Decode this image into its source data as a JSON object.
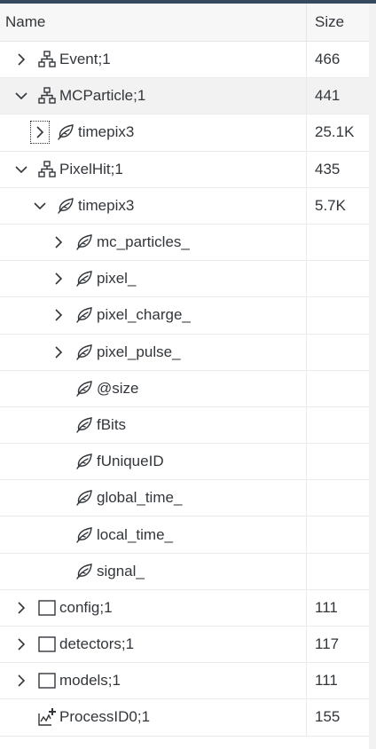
{
  "header": {
    "name": "Name",
    "size": "Size"
  },
  "rows": [
    {
      "label": "Event;1",
      "size": "466",
      "level": 0,
      "arrow": "right",
      "icon": "tree-icon",
      "selected": false,
      "focus": false
    },
    {
      "label": "MCParticle;1",
      "size": "441",
      "level": 0,
      "arrow": "down",
      "icon": "tree-icon",
      "selected": true,
      "focus": false
    },
    {
      "label": "timepix3",
      "size": "25.1K",
      "level": 1,
      "arrow": "right",
      "icon": "leaf-icon",
      "selected": false,
      "focus": true
    },
    {
      "label": "PixelHit;1",
      "size": "435",
      "level": 0,
      "arrow": "down",
      "icon": "tree-icon",
      "selected": false,
      "focus": false
    },
    {
      "label": "timepix3",
      "size": "5.7K",
      "level": 1,
      "arrow": "down",
      "icon": "leaf-icon",
      "selected": false,
      "focus": false
    },
    {
      "label": "mc_particles_",
      "size": "",
      "level": 2,
      "arrow": "right",
      "icon": "leaf-icon",
      "selected": false,
      "focus": false
    },
    {
      "label": "pixel_",
      "size": "",
      "level": 2,
      "arrow": "right",
      "icon": "leaf-icon",
      "selected": false,
      "focus": false
    },
    {
      "label": "pixel_charge_",
      "size": "",
      "level": 2,
      "arrow": "right",
      "icon": "leaf-icon",
      "selected": false,
      "focus": false
    },
    {
      "label": "pixel_pulse_",
      "size": "",
      "level": 2,
      "arrow": "right",
      "icon": "leaf-icon",
      "selected": false,
      "focus": false
    },
    {
      "label": "@size",
      "size": "",
      "level": 2,
      "arrow": "none",
      "icon": "leaf-icon",
      "selected": false,
      "focus": false
    },
    {
      "label": "fBits",
      "size": "",
      "level": 2,
      "arrow": "none",
      "icon": "leaf-icon",
      "selected": false,
      "focus": false
    },
    {
      "label": "fUniqueID",
      "size": "",
      "level": 2,
      "arrow": "none",
      "icon": "leaf-icon",
      "selected": false,
      "focus": false
    },
    {
      "label": "global_time_",
      "size": "",
      "level": 2,
      "arrow": "none",
      "icon": "leaf-icon",
      "selected": false,
      "focus": false
    },
    {
      "label": "local_time_",
      "size": "",
      "level": 2,
      "arrow": "none",
      "icon": "leaf-icon",
      "selected": false,
      "focus": false
    },
    {
      "label": "signal_",
      "size": "",
      "level": 2,
      "arrow": "none",
      "icon": "leaf-icon",
      "selected": false,
      "focus": false
    },
    {
      "label": "config;1",
      "size": "111",
      "level": 0,
      "arrow": "right",
      "icon": "folder-icon",
      "selected": false,
      "focus": false
    },
    {
      "label": "detectors;1",
      "size": "117",
      "level": 0,
      "arrow": "right",
      "icon": "folder-icon",
      "selected": false,
      "focus": false
    },
    {
      "label": "models;1",
      "size": "111",
      "level": 0,
      "arrow": "right",
      "icon": "folder-icon",
      "selected": false,
      "focus": false
    },
    {
      "label": "ProcessID0;1",
      "size": "155",
      "level": 0,
      "arrow": "none",
      "icon": "process-icon",
      "selected": false,
      "focus": false
    }
  ]
}
